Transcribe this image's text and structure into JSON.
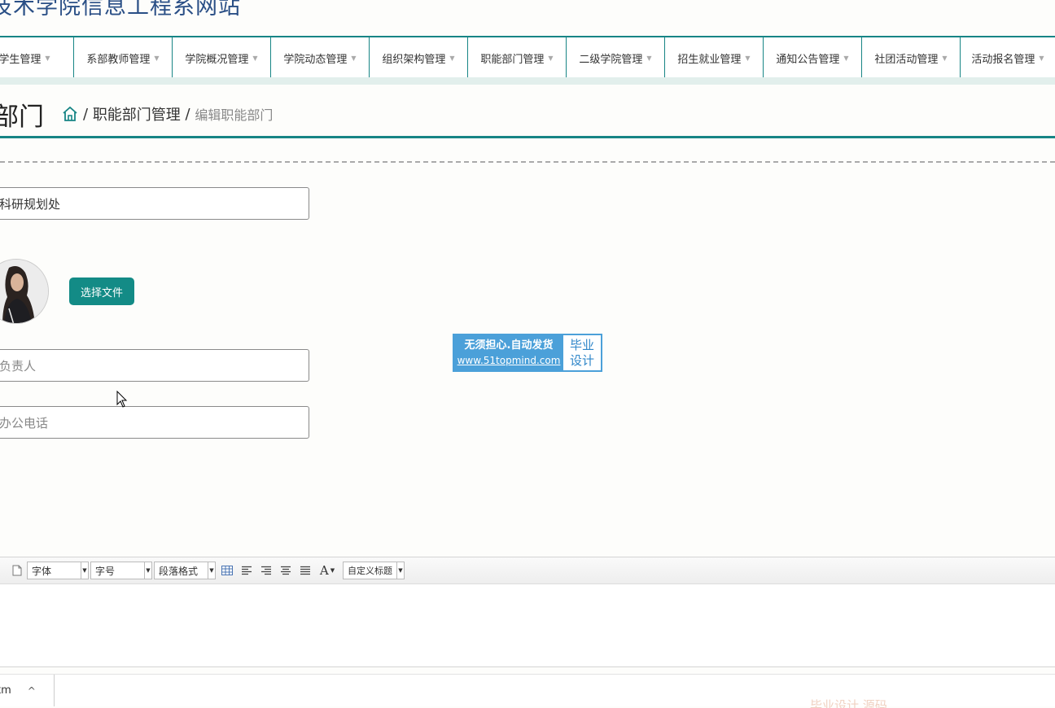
{
  "site": {
    "title": "业技术学院信息工程系网站"
  },
  "nav": {
    "items": [
      {
        "label": "学生管理"
      },
      {
        "label": "系部教师管理"
      },
      {
        "label": "学院概况管理"
      },
      {
        "label": "学院动态管理"
      },
      {
        "label": "组织架构管理"
      },
      {
        "label": "职能部门管理"
      },
      {
        "label": "二级学院管理"
      },
      {
        "label": "招生就业管理"
      },
      {
        "label": "通知公告管理"
      },
      {
        "label": "社团活动管理"
      },
      {
        "label": "活动报名管理"
      }
    ],
    "caret": "▼"
  },
  "page": {
    "title": "部门"
  },
  "breadcrumb": {
    "sep": "/",
    "section": "职能部门管理",
    "current": "编辑职能部门"
  },
  "form": {
    "dept_name_value": "科研规划处",
    "file_button": "选择文件",
    "manager_placeholder": "负责人",
    "phone_placeholder": "办公电话"
  },
  "ad": {
    "line1": "无须担心.自动发货",
    "line2": "www.51topmind.com",
    "right1": "毕业",
    "right2": "设计"
  },
  "editor": {
    "font_label": "字体",
    "size_label": "字号",
    "paragraph_label": "段落格式",
    "custom_label": "自定义标题",
    "font_color_label": "A"
  },
  "download_bar": {
    "file_label": "tm",
    "chevron": "^"
  },
  "watermark": {
    "text": "毕业设计 源码"
  },
  "colors": {
    "accent": "#178585",
    "button": "#138b86",
    "title": "#2a4f86"
  }
}
